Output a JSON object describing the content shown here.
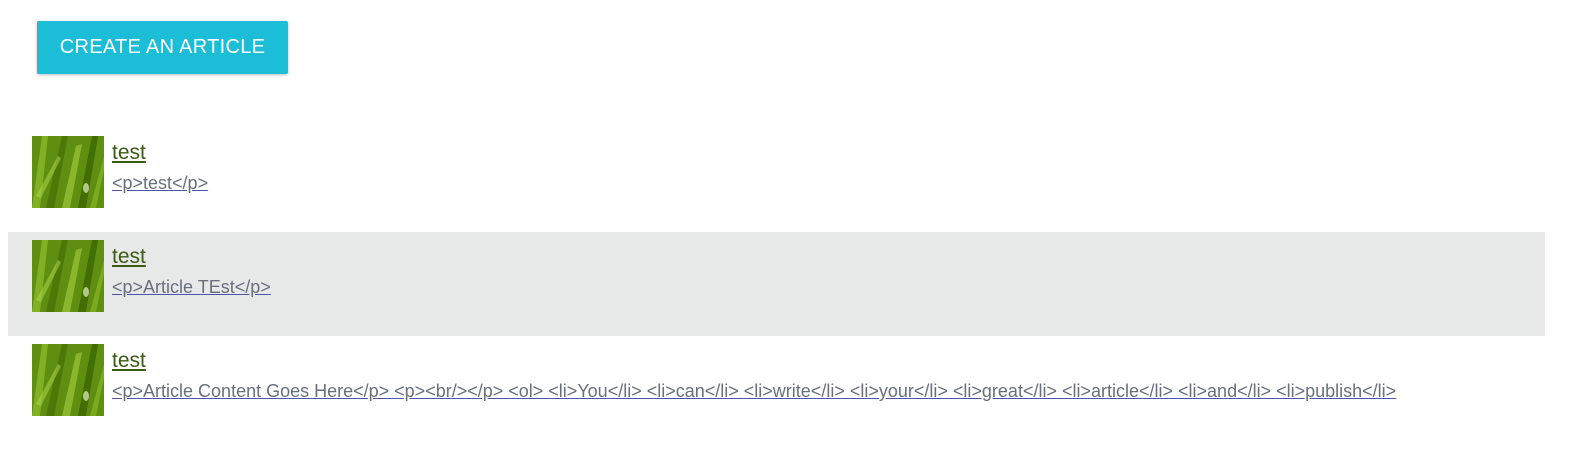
{
  "toolbar": {
    "create_label": "CREATE AN ARTICLE"
  },
  "colors": {
    "button_bg": "#1bbed6",
    "active_row_bg": "#e7e8e8",
    "title_color": "#3c5a14",
    "excerpt_color": "#6a6f7e"
  },
  "articles": [
    {
      "title": "test",
      "excerpt": "<p>test</p>",
      "thumbnail_icon": "grass-image"
    },
    {
      "title": "test",
      "excerpt": "<p>Article TEst</p>",
      "thumbnail_icon": "grass-image"
    },
    {
      "title": "test",
      "excerpt": "<p>Article Content Goes Here</p> <p><br/></p> <ol> <li>You</li> <li>can</li> <li>write</li> <li>your</li> <li>great</li> <li>article</li> <li>and</li> <li>publish</li>",
      "thumbnail_icon": "grass-image"
    }
  ]
}
